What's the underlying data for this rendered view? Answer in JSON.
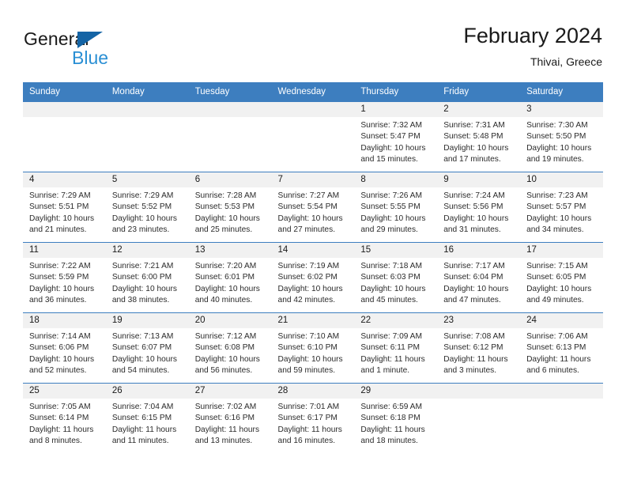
{
  "brand": {
    "name_part1": "General",
    "name_part2": "Blue",
    "triangle_icon": "blue-triangle-logo-icon",
    "accent_dark": "#1464a5",
    "accent_light": "#2a8fd4"
  },
  "header": {
    "title": "February 2024",
    "location": "Thivai, Greece",
    "bar_color": "#3d7ebf"
  },
  "weekday_headers": [
    "Sunday",
    "Monday",
    "Tuesday",
    "Wednesday",
    "Thursday",
    "Friday",
    "Saturday"
  ],
  "weeks": [
    [
      {
        "day": "",
        "sunrise": "",
        "sunset": "",
        "daylight1": "",
        "daylight2": "",
        "empty": true
      },
      {
        "day": "",
        "sunrise": "",
        "sunset": "",
        "daylight1": "",
        "daylight2": "",
        "empty": true
      },
      {
        "day": "",
        "sunrise": "",
        "sunset": "",
        "daylight1": "",
        "daylight2": "",
        "empty": true
      },
      {
        "day": "",
        "sunrise": "",
        "sunset": "",
        "daylight1": "",
        "daylight2": "",
        "empty": true
      },
      {
        "day": "1",
        "sunrise": "Sunrise: 7:32 AM",
        "sunset": "Sunset: 5:47 PM",
        "daylight1": "Daylight: 10 hours",
        "daylight2": "and 15 minutes."
      },
      {
        "day": "2",
        "sunrise": "Sunrise: 7:31 AM",
        "sunset": "Sunset: 5:48 PM",
        "daylight1": "Daylight: 10 hours",
        "daylight2": "and 17 minutes."
      },
      {
        "day": "3",
        "sunrise": "Sunrise: 7:30 AM",
        "sunset": "Sunset: 5:50 PM",
        "daylight1": "Daylight: 10 hours",
        "daylight2": "and 19 minutes."
      }
    ],
    [
      {
        "day": "4",
        "sunrise": "Sunrise: 7:29 AM",
        "sunset": "Sunset: 5:51 PM",
        "daylight1": "Daylight: 10 hours",
        "daylight2": "and 21 minutes."
      },
      {
        "day": "5",
        "sunrise": "Sunrise: 7:29 AM",
        "sunset": "Sunset: 5:52 PM",
        "daylight1": "Daylight: 10 hours",
        "daylight2": "and 23 minutes."
      },
      {
        "day": "6",
        "sunrise": "Sunrise: 7:28 AM",
        "sunset": "Sunset: 5:53 PM",
        "daylight1": "Daylight: 10 hours",
        "daylight2": "and 25 minutes."
      },
      {
        "day": "7",
        "sunrise": "Sunrise: 7:27 AM",
        "sunset": "Sunset: 5:54 PM",
        "daylight1": "Daylight: 10 hours",
        "daylight2": "and 27 minutes."
      },
      {
        "day": "8",
        "sunrise": "Sunrise: 7:26 AM",
        "sunset": "Sunset: 5:55 PM",
        "daylight1": "Daylight: 10 hours",
        "daylight2": "and 29 minutes."
      },
      {
        "day": "9",
        "sunrise": "Sunrise: 7:24 AM",
        "sunset": "Sunset: 5:56 PM",
        "daylight1": "Daylight: 10 hours",
        "daylight2": "and 31 minutes."
      },
      {
        "day": "10",
        "sunrise": "Sunrise: 7:23 AM",
        "sunset": "Sunset: 5:57 PM",
        "daylight1": "Daylight: 10 hours",
        "daylight2": "and 34 minutes."
      }
    ],
    [
      {
        "day": "11",
        "sunrise": "Sunrise: 7:22 AM",
        "sunset": "Sunset: 5:59 PM",
        "daylight1": "Daylight: 10 hours",
        "daylight2": "and 36 minutes."
      },
      {
        "day": "12",
        "sunrise": "Sunrise: 7:21 AM",
        "sunset": "Sunset: 6:00 PM",
        "daylight1": "Daylight: 10 hours",
        "daylight2": "and 38 minutes."
      },
      {
        "day": "13",
        "sunrise": "Sunrise: 7:20 AM",
        "sunset": "Sunset: 6:01 PM",
        "daylight1": "Daylight: 10 hours",
        "daylight2": "and 40 minutes."
      },
      {
        "day": "14",
        "sunrise": "Sunrise: 7:19 AM",
        "sunset": "Sunset: 6:02 PM",
        "daylight1": "Daylight: 10 hours",
        "daylight2": "and 42 minutes."
      },
      {
        "day": "15",
        "sunrise": "Sunrise: 7:18 AM",
        "sunset": "Sunset: 6:03 PM",
        "daylight1": "Daylight: 10 hours",
        "daylight2": "and 45 minutes."
      },
      {
        "day": "16",
        "sunrise": "Sunrise: 7:17 AM",
        "sunset": "Sunset: 6:04 PM",
        "daylight1": "Daylight: 10 hours",
        "daylight2": "and 47 minutes."
      },
      {
        "day": "17",
        "sunrise": "Sunrise: 7:15 AM",
        "sunset": "Sunset: 6:05 PM",
        "daylight1": "Daylight: 10 hours",
        "daylight2": "and 49 minutes."
      }
    ],
    [
      {
        "day": "18",
        "sunrise": "Sunrise: 7:14 AM",
        "sunset": "Sunset: 6:06 PM",
        "daylight1": "Daylight: 10 hours",
        "daylight2": "and 52 minutes."
      },
      {
        "day": "19",
        "sunrise": "Sunrise: 7:13 AM",
        "sunset": "Sunset: 6:07 PM",
        "daylight1": "Daylight: 10 hours",
        "daylight2": "and 54 minutes."
      },
      {
        "day": "20",
        "sunrise": "Sunrise: 7:12 AM",
        "sunset": "Sunset: 6:08 PM",
        "daylight1": "Daylight: 10 hours",
        "daylight2": "and 56 minutes."
      },
      {
        "day": "21",
        "sunrise": "Sunrise: 7:10 AM",
        "sunset": "Sunset: 6:10 PM",
        "daylight1": "Daylight: 10 hours",
        "daylight2": "and 59 minutes."
      },
      {
        "day": "22",
        "sunrise": "Sunrise: 7:09 AM",
        "sunset": "Sunset: 6:11 PM",
        "daylight1": "Daylight: 11 hours",
        "daylight2": "and 1 minute."
      },
      {
        "day": "23",
        "sunrise": "Sunrise: 7:08 AM",
        "sunset": "Sunset: 6:12 PM",
        "daylight1": "Daylight: 11 hours",
        "daylight2": "and 3 minutes."
      },
      {
        "day": "24",
        "sunrise": "Sunrise: 7:06 AM",
        "sunset": "Sunset: 6:13 PM",
        "daylight1": "Daylight: 11 hours",
        "daylight2": "and 6 minutes."
      }
    ],
    [
      {
        "day": "25",
        "sunrise": "Sunrise: 7:05 AM",
        "sunset": "Sunset: 6:14 PM",
        "daylight1": "Daylight: 11 hours",
        "daylight2": "and 8 minutes."
      },
      {
        "day": "26",
        "sunrise": "Sunrise: 7:04 AM",
        "sunset": "Sunset: 6:15 PM",
        "daylight1": "Daylight: 11 hours",
        "daylight2": "and 11 minutes."
      },
      {
        "day": "27",
        "sunrise": "Sunrise: 7:02 AM",
        "sunset": "Sunset: 6:16 PM",
        "daylight1": "Daylight: 11 hours",
        "daylight2": "and 13 minutes."
      },
      {
        "day": "28",
        "sunrise": "Sunrise: 7:01 AM",
        "sunset": "Sunset: 6:17 PM",
        "daylight1": "Daylight: 11 hours",
        "daylight2": "and 16 minutes."
      },
      {
        "day": "29",
        "sunrise": "Sunrise: 6:59 AM",
        "sunset": "Sunset: 6:18 PM",
        "daylight1": "Daylight: 11 hours",
        "daylight2": "and 18 minutes."
      },
      {
        "day": "",
        "sunrise": "",
        "sunset": "",
        "daylight1": "",
        "daylight2": "",
        "empty": true
      },
      {
        "day": "",
        "sunrise": "",
        "sunset": "",
        "daylight1": "",
        "daylight2": "",
        "empty": true
      }
    ]
  ]
}
